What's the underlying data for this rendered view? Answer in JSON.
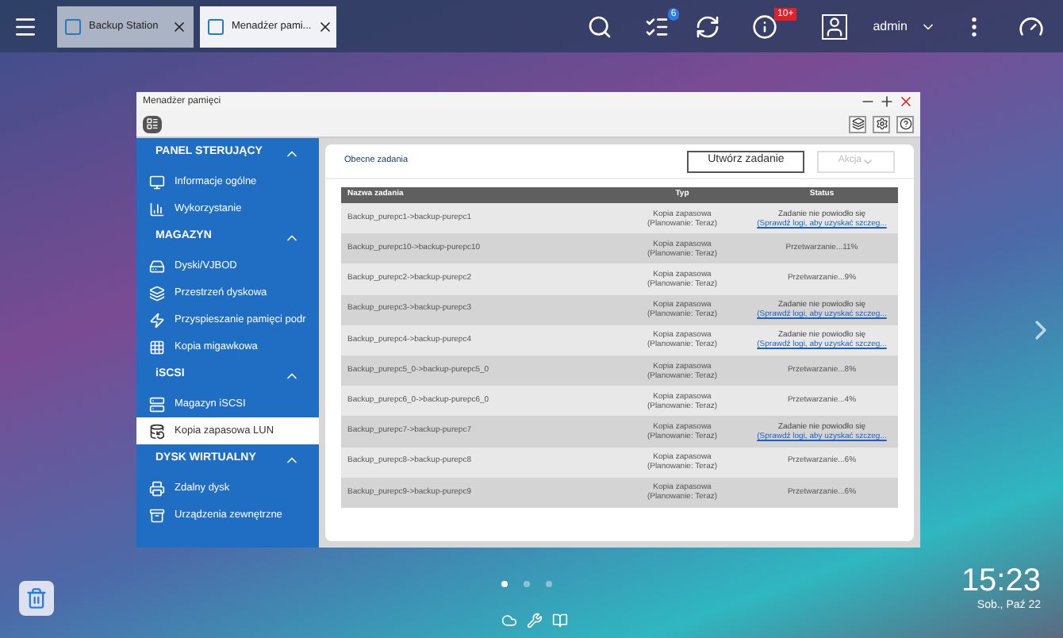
{
  "taskbar": {
    "tabs": [
      {
        "label": "Backup Station",
        "selected": false
      },
      {
        "label": "Menadżer pami...",
        "selected": true
      }
    ],
    "badges": {
      "tasks": "6",
      "notifications": "10+"
    },
    "user": "admin"
  },
  "window": {
    "title": "Menadżer pamięci",
    "sidebar": [
      {
        "title": "PANEL STERUJĄCY",
        "expanded": true,
        "items": [
          {
            "label": "Informacje ogólne",
            "selected": false
          },
          {
            "label": "Wykorzystanie",
            "selected": false
          }
        ]
      },
      {
        "title": "MAGAZYN",
        "expanded": true,
        "items": [
          {
            "label": "Dyski/VJBOD",
            "selected": false
          },
          {
            "label": "Przestrzeń dyskowa",
            "selected": false
          },
          {
            "label": "Przyspieszanie pamięci podr",
            "selected": false
          },
          {
            "label": "Kopia migawkowa",
            "selected": false
          }
        ]
      },
      {
        "title": "iSCSI",
        "expanded": true,
        "items": [
          {
            "label": "Magazyn iSCSI",
            "selected": false
          },
          {
            "label": "Kopia zapasowa LUN",
            "selected": true
          }
        ]
      },
      {
        "title": "DYSK WIRTUALNY",
        "expanded": true,
        "items": [
          {
            "label": "Zdalny dysk",
            "selected": false
          },
          {
            "label": "Urządzenia zewnętrzne",
            "selected": false
          }
        ]
      }
    ],
    "content": {
      "tab": "Obecne zadania",
      "create_button": "Utwórz zadanie",
      "action_button": {
        "label": "Akcja",
        "disabled": true
      },
      "table": {
        "columns": [
          "Nazwa zadania",
          "Typ",
          "Status"
        ],
        "rows": [
          {
            "name": "Backup_purepc1->backup-purepc1",
            "type": "Kopia zapasowa",
            "schedule": "(Planowanie: Teraz)",
            "status": {
              "kind": "failed",
              "text": "Zadanie nie powiodło się",
              "link": "(Sprawdź logi, aby uzyskać szczeg..."
            }
          },
          {
            "name": "Backup_purepc10->backup-purepc10",
            "type": "Kopia zapasowa",
            "schedule": "(Planowanie: Teraz)",
            "status": {
              "kind": "progress",
              "text": "Przetwarzanie...11%"
            }
          },
          {
            "name": "Backup_purepc2->backup-purepc2",
            "type": "Kopia zapasowa",
            "schedule": "(Planowanie: Teraz)",
            "status": {
              "kind": "progress",
              "text": "Przetwarzanie...9%"
            }
          },
          {
            "name": "Backup_purepc3->backup-purepc3",
            "type": "Kopia zapasowa",
            "schedule": "(Planowanie: Teraz)",
            "status": {
              "kind": "failed",
              "text": "Zadanie nie powiodło się",
              "link": "(Sprawdź logi, aby uzyskać szczeg..."
            }
          },
          {
            "name": "Backup_purepc4->backup-purepc4",
            "type": "Kopia zapasowa",
            "schedule": "(Planowanie: Teraz)",
            "status": {
              "kind": "failed",
              "text": "Zadanie nie powiodło się",
              "link": "(Sprawdź logi, aby uzyskać szczeg..."
            }
          },
          {
            "name": "Backup_purepc5_0->backup-purepc5_0",
            "type": "Kopia zapasowa",
            "schedule": "(Planowanie: Teraz)",
            "status": {
              "kind": "progress",
              "text": "Przetwarzanie...8%"
            }
          },
          {
            "name": "Backup_purepc6_0->backup-purepc6_0",
            "type": "Kopia zapasowa",
            "schedule": "(Planowanie: Teraz)",
            "status": {
              "kind": "progress",
              "text": "Przetwarzanie...4%"
            }
          },
          {
            "name": "Backup_purepc7->backup-purepc7",
            "type": "Kopia zapasowa",
            "schedule": "(Planowanie: Teraz)",
            "status": {
              "kind": "failed",
              "text": "Zadanie nie powiodło się",
              "link": "(Sprawdź logi, aby uzyskać szczeg..."
            }
          },
          {
            "name": "Backup_purepc8->backup-purepc8",
            "type": "Kopia zapasowa",
            "schedule": "(Planowanie: Teraz)",
            "status": {
              "kind": "progress",
              "text": "Przetwarzanie...6%"
            }
          },
          {
            "name": "Backup_purepc9->backup-purepc9",
            "type": "Kopia zapasowa",
            "schedule": "(Planowanie: Teraz)",
            "status": {
              "kind": "progress",
              "text": "Przetwarzanie...6%"
            }
          }
        ]
      }
    }
  },
  "desktop": {
    "pages": [
      {
        "selected": true
      },
      {
        "selected": false
      },
      {
        "selected": false
      }
    ],
    "time": "15:23",
    "date": "Sob., Paź 22"
  }
}
